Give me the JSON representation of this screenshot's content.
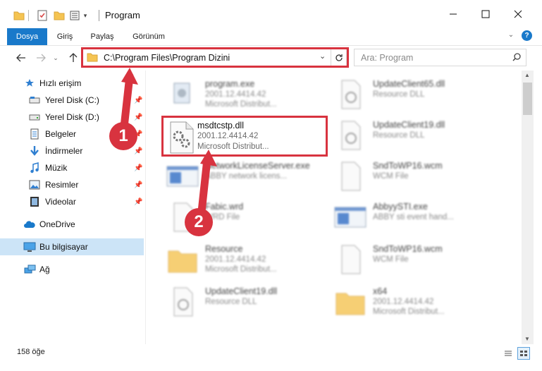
{
  "window": {
    "title": "Program"
  },
  "ribbon": {
    "tabs": [
      "Dosya",
      "Giriş",
      "Paylaş",
      "Görünüm"
    ]
  },
  "nav": {
    "address": "C:\\Program Files\\Program Dizini",
    "search_placeholder": "Ara: Program"
  },
  "sidebar": {
    "quick_access": "Hızlı erişim",
    "items": [
      {
        "label": "Yerel Disk (C:)",
        "icon": "drive-icon"
      },
      {
        "label": "Yerel Disk (D:)",
        "icon": "drive-icon"
      },
      {
        "label": "Belgeler",
        "icon": "documents-icon"
      },
      {
        "label": "İndirmeler",
        "icon": "download-icon"
      },
      {
        "label": "Müzik",
        "icon": "music-icon"
      },
      {
        "label": "Resimler",
        "icon": "pictures-icon"
      },
      {
        "label": "Videolar",
        "icon": "videos-icon"
      }
    ],
    "onedrive": "OneDrive",
    "this_pc": "Bu bilgisayar",
    "network": "Ağ"
  },
  "files": [
    {
      "name": "program.exe",
      "line2": "2001.12.4414.42",
      "line3": "Microsoft Distribut...",
      "kind": "exe"
    },
    {
      "name": "UpdateClient65.dll",
      "line2": "Resource DLL",
      "line3": "",
      "kind": "dll"
    },
    {
      "name": "msdtcstp.dll",
      "line2": "2001.12.4414.42",
      "line3": "Microsoft Distribut...",
      "kind": "dll"
    },
    {
      "name": "UpdateClient19.dll",
      "line2": "Resource DLL",
      "line3": "",
      "kind": "dll"
    },
    {
      "name": "NetworkLicenseServer.exe",
      "line2": "ABBY network licens...",
      "line3": "",
      "kind": "exe-window"
    },
    {
      "name": "SndToWP16.wcm",
      "line2": "WCM File",
      "line3": "",
      "kind": "file"
    },
    {
      "name": "Fabic.wrd",
      "line2": "WRD File",
      "line3": "",
      "kind": "file"
    },
    {
      "name": "AbbyySTI.exe",
      "line2": "ABBY sti event hand...",
      "line3": "",
      "kind": "exe-window"
    },
    {
      "name": "Resource",
      "line2": "2001.12.4414.42",
      "line3": "Microsoft Distribut...",
      "kind": "folder"
    },
    {
      "name": "SndToWP16.wcm",
      "line2": "WCM File",
      "line3": "",
      "kind": "file"
    },
    {
      "name": "UpdateClient19.dll",
      "line2": "Resource DLL",
      "line3": "",
      "kind": "dll"
    },
    {
      "name": "x64",
      "line2": "2001.12.4414.42",
      "line3": "Microsoft Distribut...",
      "kind": "folder"
    }
  ],
  "status": {
    "count": "158 öğe"
  },
  "annotations": {
    "step1": "1",
    "step2": "2",
    "color": "#d8333f"
  }
}
